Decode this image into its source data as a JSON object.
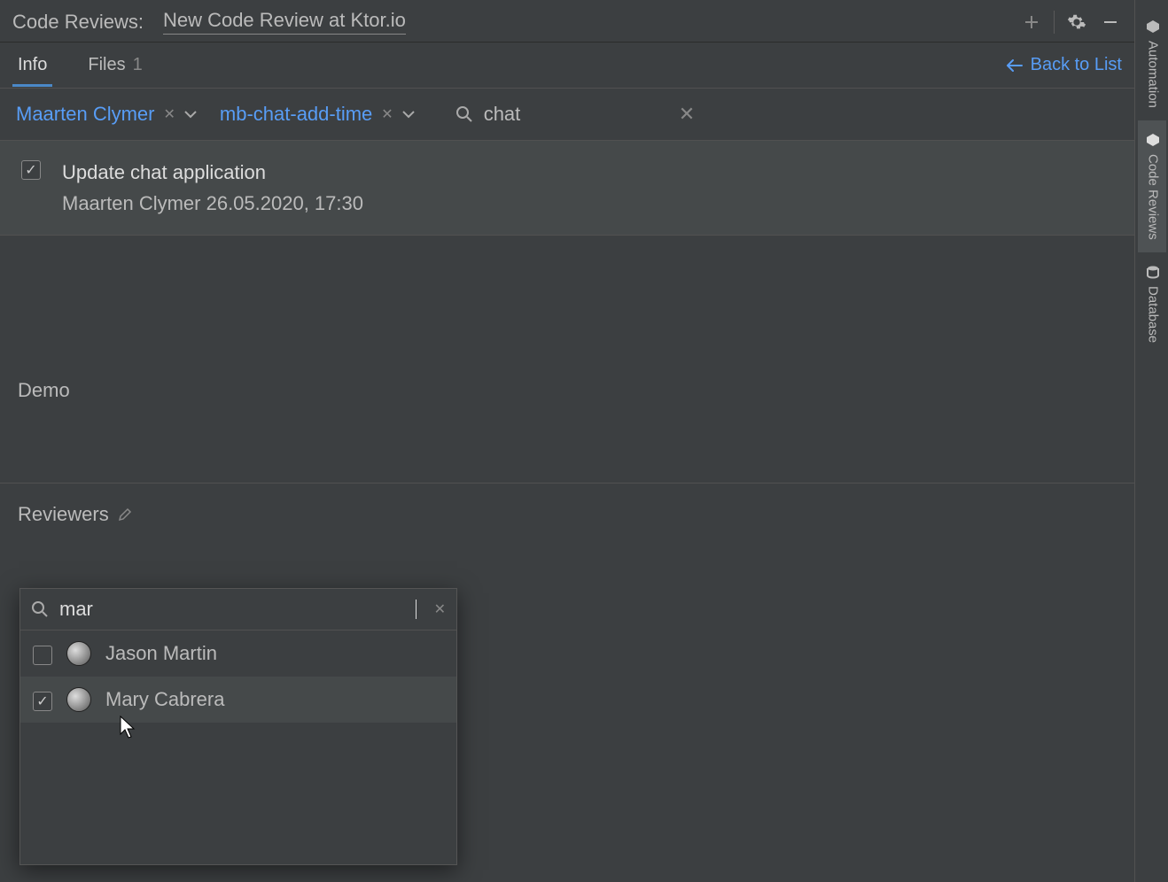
{
  "header": {
    "panel_title": "Code Reviews:",
    "review_title": "New Code Review at Ktor.io"
  },
  "tabs": {
    "info": "Info",
    "files": "Files",
    "files_count": "1",
    "back": "Back to List"
  },
  "filters": {
    "author": "Maarten Clymer",
    "branch": "mb-chat-add-time",
    "search_value": "chat"
  },
  "commit": {
    "title": "Update chat application",
    "meta": "Maarten Clymer 26.05.2020, 17:30"
  },
  "demo_label": "Demo",
  "reviewers_label": "Reviewers",
  "popup": {
    "query": "mar",
    "items": [
      {
        "name": "Jason Martin",
        "checked": false
      },
      {
        "name": "Mary Cabrera",
        "checked": true
      }
    ]
  },
  "rail": {
    "automation": "Automation",
    "code_reviews": "Code Reviews",
    "database": "Database"
  }
}
